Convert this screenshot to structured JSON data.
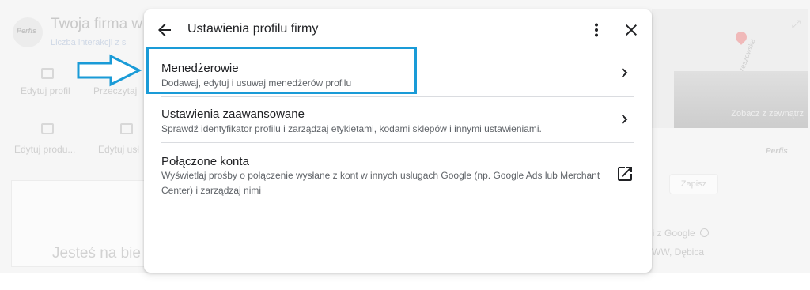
{
  "background": {
    "business_title": "Twoja firma w",
    "business_subtitle": "Liczba interakcji z s",
    "logo_text": "Perfis",
    "actions_row1": [
      {
        "label": "Edytuj profil",
        "icon": "storefront-icon"
      },
      {
        "label": "Przeczytaj",
        "icon": "star-icon"
      }
    ],
    "actions_row2": [
      {
        "label": "Edytuj produ...",
        "icon": "shopping-bag-icon"
      },
      {
        "label": "Edytuj usł",
        "icon": "list-icon"
      }
    ],
    "lead_text": "Jesteś na bie",
    "map_street": "Rzeszowska",
    "street_view_label": "Zobacz z zewnątrz",
    "brand_small": "Perfis",
    "save_label": "Zapisz",
    "google_note": "ni z Google",
    "address": "WW, Dębica"
  },
  "dialog": {
    "title": "Ustawienia profilu firmy",
    "items": [
      {
        "label": "Menedżerowie",
        "description": "Dodawaj, edytuj i usuwaj menedżerów profilu",
        "trailing_icon": "chevron-right-icon"
      },
      {
        "label": "Ustawienia zaawansowane",
        "description": "Sprawdź identyfikator profilu i zarządzaj etykietami, kodami sklepów i innymi ustawieniami.",
        "trailing_icon": "chevron-right-icon"
      },
      {
        "label": "Połączone konta",
        "description": "Wyświetlaj prośby o połączenie wysłane z kont w innych usługach Google (np. Google Ads lub Merchant Center) i zarządzaj nimi",
        "trailing_icon": "open-in-new-icon"
      }
    ]
  },
  "annotation": {
    "highlight_color": "#1a9bd7",
    "arrow_icon": "arrow-right-icon"
  }
}
